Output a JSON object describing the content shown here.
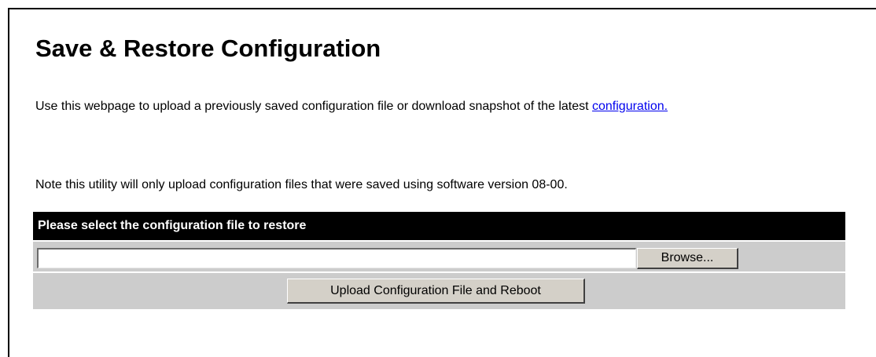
{
  "page": {
    "title": "Save & Restore Configuration",
    "intro_text": "Use this webpage to upload a previously saved configuration file or download snapshot of the latest ",
    "intro_link": "configuration.",
    "note": "Note this utility will only upload configuration files that were saved using software version 08-00."
  },
  "restore": {
    "header": "Please select the configuration file to restore",
    "file_value": "",
    "browse_label": "Browse...",
    "upload_label": "Upload Configuration File and Reboot"
  }
}
